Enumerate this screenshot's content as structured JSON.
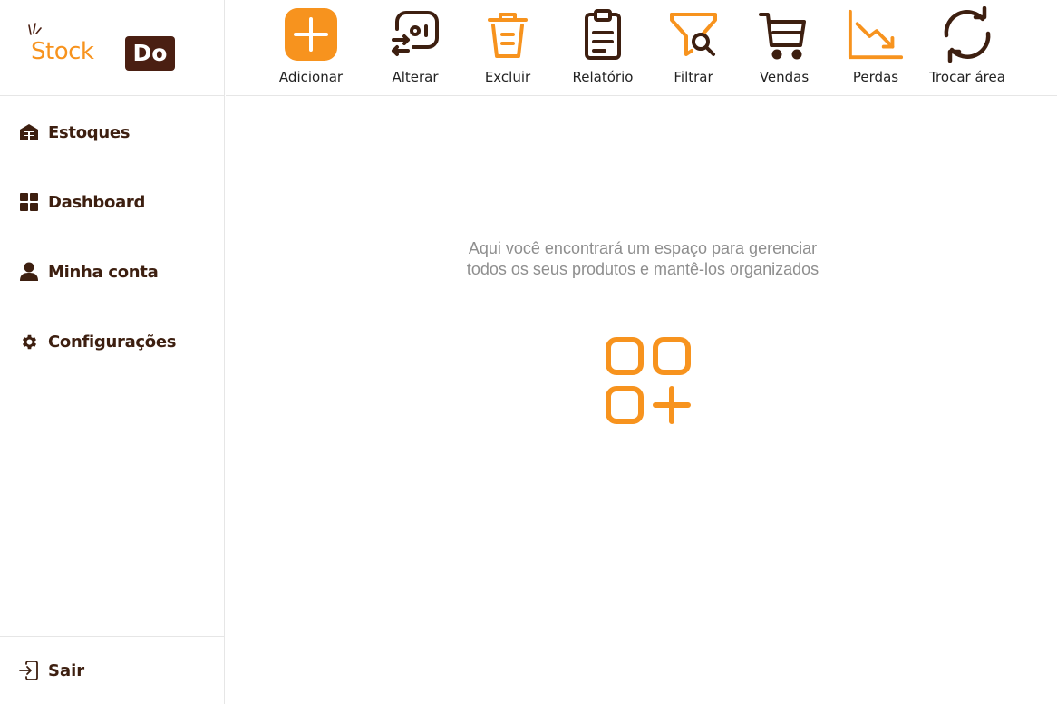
{
  "brand": {
    "stock": "Stock",
    "do": "Do"
  },
  "colors": {
    "accent": "#f7931e",
    "dark": "#3d1f10"
  },
  "toolbar": [
    {
      "label": "Adicionar",
      "icon": "plus-icon"
    },
    {
      "label": "Alterar",
      "icon": "edit-icon"
    },
    {
      "label": "Excluir",
      "icon": "trash-icon"
    },
    {
      "label": "Relatório",
      "icon": "clipboard-icon"
    },
    {
      "label": "Filtrar",
      "icon": "filter-icon"
    },
    {
      "label": "Vendas",
      "icon": "cart-icon"
    },
    {
      "label": "Perdas",
      "icon": "trend-down-icon"
    },
    {
      "label": "Trocar área",
      "icon": "refresh-icon"
    }
  ],
  "sidebar": {
    "items": [
      {
        "label": "Estoques",
        "icon": "warehouse-icon"
      },
      {
        "label": "Dashboard",
        "icon": "grid-icon"
      },
      {
        "label": "Minha conta",
        "icon": "user-icon"
      },
      {
        "label": "Configurações",
        "icon": "gear-icon"
      }
    ],
    "logout": {
      "label": "Sair",
      "icon": "logout-icon"
    }
  },
  "main": {
    "empty_message": "Aqui você encontrará um espaço para gerenciar todos os seus produtos e mantê-los organizados"
  }
}
